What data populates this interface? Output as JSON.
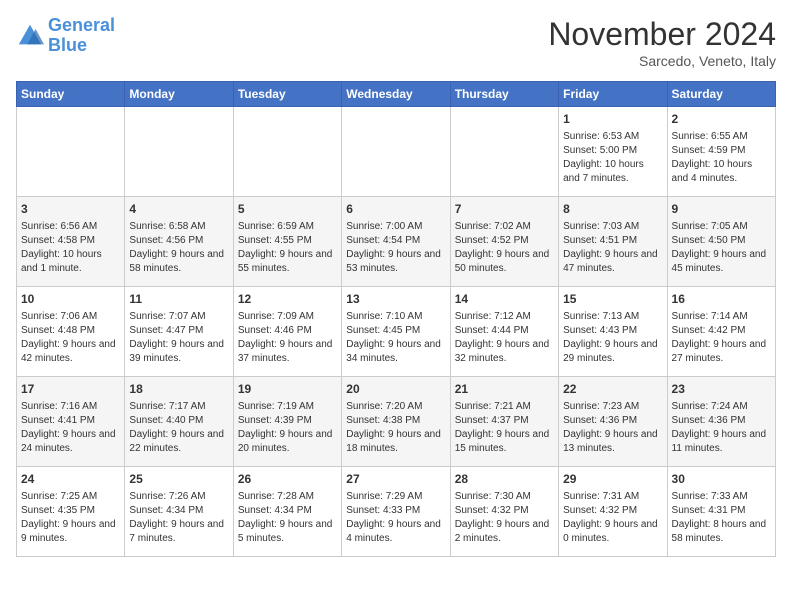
{
  "header": {
    "logo_line1": "General",
    "logo_line2": "Blue",
    "month": "November 2024",
    "location": "Sarcedo, Veneto, Italy"
  },
  "days_of_week": [
    "Sunday",
    "Monday",
    "Tuesday",
    "Wednesday",
    "Thursday",
    "Friday",
    "Saturday"
  ],
  "weeks": [
    [
      {
        "day": "",
        "info": ""
      },
      {
        "day": "",
        "info": ""
      },
      {
        "day": "",
        "info": ""
      },
      {
        "day": "",
        "info": ""
      },
      {
        "day": "",
        "info": ""
      },
      {
        "day": "1",
        "info": "Sunrise: 6:53 AM\nSunset: 5:00 PM\nDaylight: 10 hours and 7 minutes."
      },
      {
        "day": "2",
        "info": "Sunrise: 6:55 AM\nSunset: 4:59 PM\nDaylight: 10 hours and 4 minutes."
      }
    ],
    [
      {
        "day": "3",
        "info": "Sunrise: 6:56 AM\nSunset: 4:58 PM\nDaylight: 10 hours and 1 minute."
      },
      {
        "day": "4",
        "info": "Sunrise: 6:58 AM\nSunset: 4:56 PM\nDaylight: 9 hours and 58 minutes."
      },
      {
        "day": "5",
        "info": "Sunrise: 6:59 AM\nSunset: 4:55 PM\nDaylight: 9 hours and 55 minutes."
      },
      {
        "day": "6",
        "info": "Sunrise: 7:00 AM\nSunset: 4:54 PM\nDaylight: 9 hours and 53 minutes."
      },
      {
        "day": "7",
        "info": "Sunrise: 7:02 AM\nSunset: 4:52 PM\nDaylight: 9 hours and 50 minutes."
      },
      {
        "day": "8",
        "info": "Sunrise: 7:03 AM\nSunset: 4:51 PM\nDaylight: 9 hours and 47 minutes."
      },
      {
        "day": "9",
        "info": "Sunrise: 7:05 AM\nSunset: 4:50 PM\nDaylight: 9 hours and 45 minutes."
      }
    ],
    [
      {
        "day": "10",
        "info": "Sunrise: 7:06 AM\nSunset: 4:48 PM\nDaylight: 9 hours and 42 minutes."
      },
      {
        "day": "11",
        "info": "Sunrise: 7:07 AM\nSunset: 4:47 PM\nDaylight: 9 hours and 39 minutes."
      },
      {
        "day": "12",
        "info": "Sunrise: 7:09 AM\nSunset: 4:46 PM\nDaylight: 9 hours and 37 minutes."
      },
      {
        "day": "13",
        "info": "Sunrise: 7:10 AM\nSunset: 4:45 PM\nDaylight: 9 hours and 34 minutes."
      },
      {
        "day": "14",
        "info": "Sunrise: 7:12 AM\nSunset: 4:44 PM\nDaylight: 9 hours and 32 minutes."
      },
      {
        "day": "15",
        "info": "Sunrise: 7:13 AM\nSunset: 4:43 PM\nDaylight: 9 hours and 29 minutes."
      },
      {
        "day": "16",
        "info": "Sunrise: 7:14 AM\nSunset: 4:42 PM\nDaylight: 9 hours and 27 minutes."
      }
    ],
    [
      {
        "day": "17",
        "info": "Sunrise: 7:16 AM\nSunset: 4:41 PM\nDaylight: 9 hours and 24 minutes."
      },
      {
        "day": "18",
        "info": "Sunrise: 7:17 AM\nSunset: 4:40 PM\nDaylight: 9 hours and 22 minutes."
      },
      {
        "day": "19",
        "info": "Sunrise: 7:19 AM\nSunset: 4:39 PM\nDaylight: 9 hours and 20 minutes."
      },
      {
        "day": "20",
        "info": "Sunrise: 7:20 AM\nSunset: 4:38 PM\nDaylight: 9 hours and 18 minutes."
      },
      {
        "day": "21",
        "info": "Sunrise: 7:21 AM\nSunset: 4:37 PM\nDaylight: 9 hours and 15 minutes."
      },
      {
        "day": "22",
        "info": "Sunrise: 7:23 AM\nSunset: 4:36 PM\nDaylight: 9 hours and 13 minutes."
      },
      {
        "day": "23",
        "info": "Sunrise: 7:24 AM\nSunset: 4:36 PM\nDaylight: 9 hours and 11 minutes."
      }
    ],
    [
      {
        "day": "24",
        "info": "Sunrise: 7:25 AM\nSunset: 4:35 PM\nDaylight: 9 hours and 9 minutes."
      },
      {
        "day": "25",
        "info": "Sunrise: 7:26 AM\nSunset: 4:34 PM\nDaylight: 9 hours and 7 minutes."
      },
      {
        "day": "26",
        "info": "Sunrise: 7:28 AM\nSunset: 4:34 PM\nDaylight: 9 hours and 5 minutes."
      },
      {
        "day": "27",
        "info": "Sunrise: 7:29 AM\nSunset: 4:33 PM\nDaylight: 9 hours and 4 minutes."
      },
      {
        "day": "28",
        "info": "Sunrise: 7:30 AM\nSunset: 4:32 PM\nDaylight: 9 hours and 2 minutes."
      },
      {
        "day": "29",
        "info": "Sunrise: 7:31 AM\nSunset: 4:32 PM\nDaylight: 9 hours and 0 minutes."
      },
      {
        "day": "30",
        "info": "Sunrise: 7:33 AM\nSunset: 4:31 PM\nDaylight: 8 hours and 58 minutes."
      }
    ]
  ]
}
